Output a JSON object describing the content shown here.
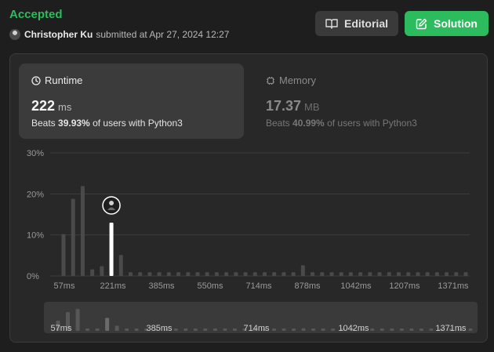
{
  "header": {
    "status": "Accepted",
    "username": "Christopher Ku",
    "submitted_text": "submitted at Apr 27, 2024 12:27",
    "editorial_label": "Editorial",
    "solution_label": "Solution"
  },
  "runtime": {
    "title": "Runtime",
    "value": "222",
    "unit": "ms",
    "beats_prefix": "Beats",
    "beats_pct": "39.93%",
    "beats_suffix": "of users with Python3"
  },
  "memory": {
    "title": "Memory",
    "value": "17.37",
    "unit": "MB",
    "beats_prefix": "Beats",
    "beats_pct": "40.99%",
    "beats_suffix": "of users with Python3"
  },
  "colors": {
    "accent": "#2cbb5d",
    "bar": "#4a4a4a",
    "highlight_bar": "#ffffff"
  },
  "chart_data": {
    "type": "bar",
    "ylim": [
      0,
      30
    ],
    "y_ticks": [
      "30%",
      "20%",
      "10%",
      "0%"
    ],
    "x_ticks": [
      "57ms",
      "221ms",
      "385ms",
      "550ms",
      "714ms",
      "878ms",
      "1042ms",
      "1207ms",
      "1371ms"
    ],
    "mini_x_ticks": [
      "57ms",
      "385ms",
      "714ms",
      "1042ms",
      "1371ms"
    ],
    "values": [
      10.2,
      18.8,
      21.9,
      1.6,
      2.4,
      13.0,
      5.1,
      0.9,
      0.9,
      0.9,
      0.9,
      0.9,
      0.9,
      0.9,
      0.9,
      0.9,
      0.9,
      0.9,
      0.9,
      0.9,
      0.9,
      0.9,
      0.9,
      0.9,
      0.9,
      2.6,
      0.9,
      0.9,
      0.9,
      0.9,
      0.9,
      0.9,
      0.9,
      0.9,
      0.9,
      0.9,
      0.9,
      0.9,
      0.9,
      0.9,
      0.9,
      0.9,
      0.9
    ],
    "highlight_index": 5
  }
}
